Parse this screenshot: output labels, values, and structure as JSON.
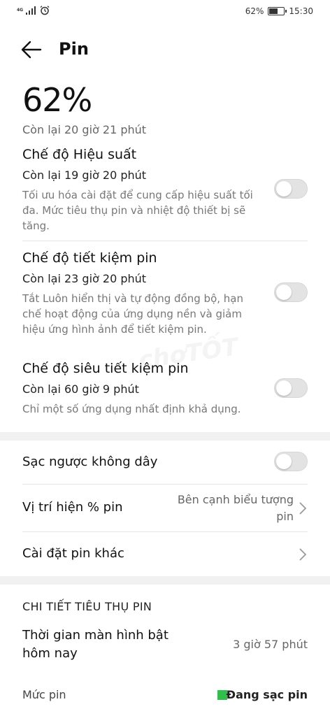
{
  "status_bar": {
    "network": "4G",
    "battery_percent": "62%",
    "battery_level": 0.62,
    "time": "15:30"
  },
  "header": {
    "title": "Pin"
  },
  "battery": {
    "percent": "62%",
    "remaining": "Còn lại 20 giờ 21 phút"
  },
  "modes": [
    {
      "title": "Chế độ Hiệu suất",
      "remaining": "Còn lại 19 giờ 20 phút",
      "desc": "Tối ưu hóa cài đặt để cung cấp hiệu suất tối đa. Mức tiêu thụ pin và nhiệt độ thiết bị sẽ tăng.",
      "enabled": false
    },
    {
      "title": "Chế độ tiết kiệm pin",
      "remaining": "Còn lại 23 giờ 20 phút",
      "desc": "Tắt Luôn hiển thị và tự động đồng bộ, hạn chế hoạt động của ứng dụng nền và giảm hiệu ứng hình ảnh để tiết kiệm pin.",
      "enabled": false
    },
    {
      "title": "Chế độ siêu tiết kiệm pin",
      "remaining": "Còn lại 60 giờ 9 phút",
      "desc": "Chỉ một số ứng dụng nhất định khả dụng.",
      "enabled": false
    }
  ],
  "settings": {
    "reverse_charge": {
      "label": "Sạc ngược không dây",
      "enabled": false
    },
    "percent_position": {
      "label": "Vị trí hiện % pin",
      "value_line1": "Bên cạnh biểu tượng",
      "value_line2": "pin"
    },
    "other_settings": {
      "label": "Cài đặt pin khác"
    }
  },
  "details": {
    "heading": "CHI TIẾT TIÊU THỤ PIN",
    "screen_on_label_line1": "Thời gian màn hình bật",
    "screen_on_label_line2": "hôm nay",
    "screen_on_value": "3 giờ 57 phút",
    "level_label": "Mức pin",
    "charging_status": "Đang sạc pin",
    "charging_color": "#2fbf4a"
  },
  "watermark": "chợTỐT"
}
